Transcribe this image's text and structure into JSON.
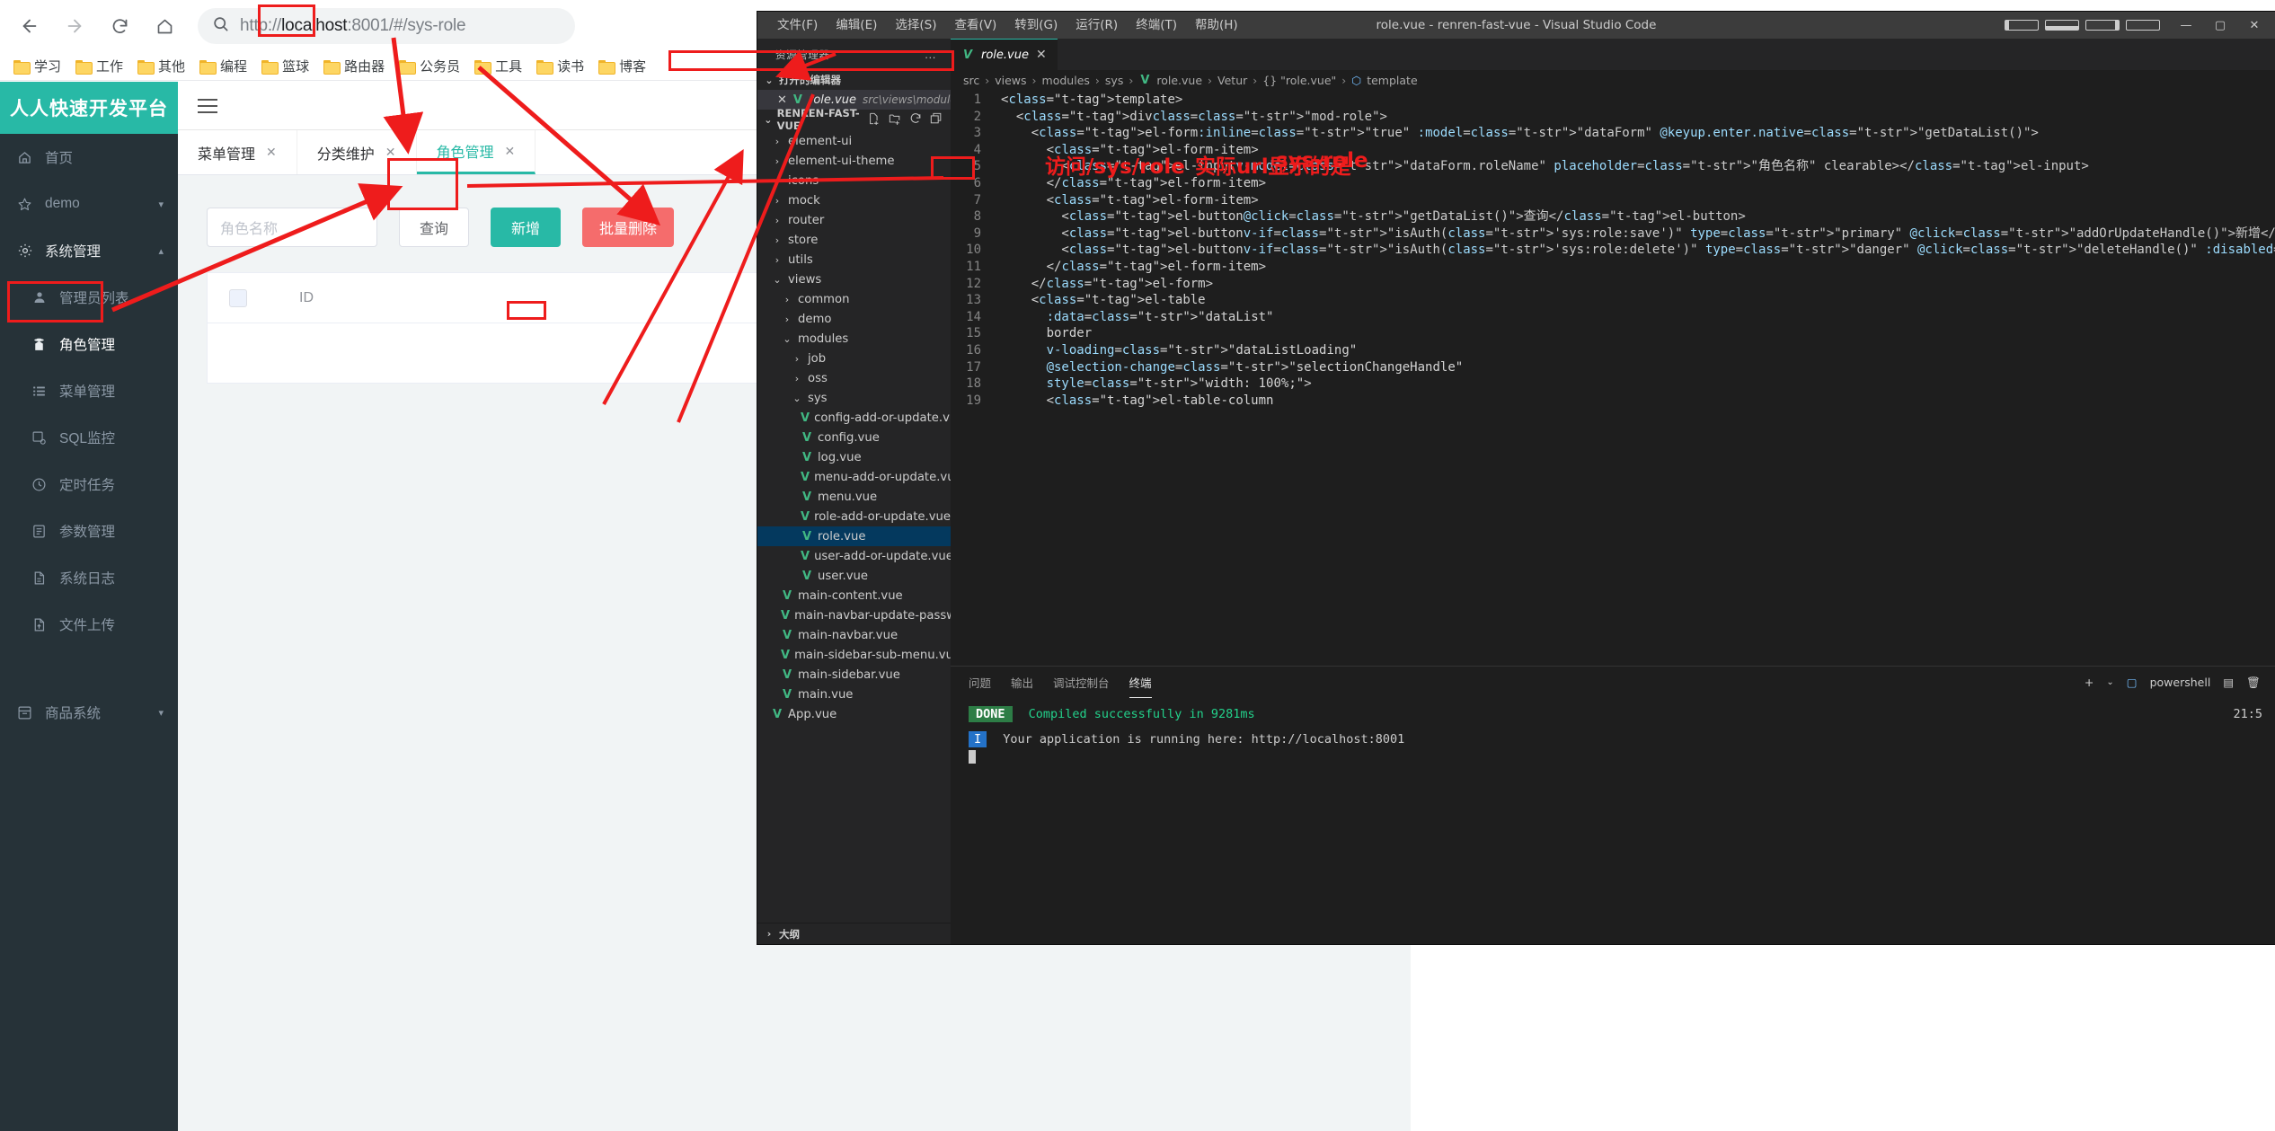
{
  "browser": {
    "nav": {
      "back": "back-arrow",
      "forward": "forward-arrow",
      "reload": "reload",
      "home": "home"
    },
    "omnibox": {
      "search_icon": "search-icon",
      "url_scheme": "http://",
      "url_host": "localhost",
      "url_port": ":8001",
      "url_hash": "/#",
      "url_path": "/sys-role",
      "full_url": "http://localhost:8001/#/sys-role"
    },
    "bookmarks": [
      {
        "label": "学习"
      },
      {
        "label": "工作"
      },
      {
        "label": "其他"
      },
      {
        "label": "编程"
      },
      {
        "label": "篮球"
      },
      {
        "label": "路由器"
      },
      {
        "label": "公务员"
      },
      {
        "label": "工具"
      },
      {
        "label": "读书"
      },
      {
        "label": "博客"
      }
    ]
  },
  "app": {
    "logo": "人人快速开发平台",
    "menu": [
      {
        "label": "首页",
        "icon": "home-icon",
        "level": "top",
        "chevron": ""
      },
      {
        "label": "demo",
        "icon": "star-icon",
        "level": "top",
        "chevron": "▾"
      },
      {
        "label": "系统管理",
        "icon": "gear-icon",
        "level": "top",
        "chevron": "▴",
        "expanded": true
      },
      {
        "label": "管理员列表",
        "icon": "user-icon",
        "level": "sub"
      },
      {
        "label": "角色管理",
        "icon": "role-icon",
        "level": "sub",
        "active": true
      },
      {
        "label": "菜单管理",
        "icon": "list-icon",
        "level": "sub"
      },
      {
        "label": "SQL监控",
        "icon": "sql-icon",
        "level": "sub"
      },
      {
        "label": "定时任务",
        "icon": "clock-icon",
        "level": "sub"
      },
      {
        "label": "参数管理",
        "icon": "params-icon",
        "level": "sub"
      },
      {
        "label": "系统日志",
        "icon": "log-icon",
        "level": "sub"
      },
      {
        "label": "文件上传",
        "icon": "upload-icon",
        "level": "sub"
      },
      {
        "label": "商品系统",
        "icon": "shop-icon",
        "level": "top",
        "chevron": "▾"
      }
    ],
    "navbar": {
      "hamburger": "hamburger-icon"
    },
    "tabs": [
      {
        "label": "菜单管理",
        "closable": true,
        "selected": false
      },
      {
        "label": "分类维护",
        "closable": true,
        "selected": false
      },
      {
        "label": "角色管理",
        "closable": true,
        "selected": true
      }
    ],
    "search": {
      "role_name_placeholder": "角色名称",
      "role_name_value": "",
      "query_button": "查询",
      "add_button": "新增",
      "delete_button": "批量删除"
    },
    "table": {
      "columns": [
        "",
        "ID"
      ],
      "rows": []
    }
  },
  "vscode": {
    "title": "role.vue - renren-fast-vue - Visual Studio Code",
    "menu": [
      "文件(F)",
      "编辑(E)",
      "选择(S)",
      "查看(V)",
      "转到(G)",
      "运行(R)",
      "终端(T)",
      "帮助(H)"
    ],
    "window_controls": {
      "minimize": "—",
      "maximize": "▢",
      "close": "✕"
    },
    "layout_icons": [
      "panel-left-icon",
      "panel-bottom-icon",
      "panel-right-icon",
      "layout-icon"
    ],
    "sidebar": {
      "title": "资源管理器",
      "more": "...",
      "open_editors": {
        "label": "打开的编辑器",
        "chevron": "⌄",
        "items": [
          {
            "close": "✕",
            "icon": "vue-icon",
            "name": "role.vue",
            "path": "src\\views\\modules\\sys"
          }
        ]
      },
      "project": {
        "name": "RENREN-FAST-VUE",
        "chevron": "⌄",
        "actions": [
          "new-file-icon",
          "new-folder-icon",
          "refresh-icon",
          "collapse-icon"
        ]
      },
      "tree": [
        {
          "label": "element-ui",
          "type": "folder",
          "indent": 1,
          "chevron": "›"
        },
        {
          "label": "element-ui-theme",
          "type": "folder",
          "indent": 1,
          "chevron": "›"
        },
        {
          "label": "icons",
          "type": "folder",
          "indent": 1,
          "chevron": "›"
        },
        {
          "label": "mock",
          "type": "folder",
          "indent": 1,
          "chevron": "›"
        },
        {
          "label": "router",
          "type": "folder",
          "indent": 1,
          "chevron": "›"
        },
        {
          "label": "store",
          "type": "folder",
          "indent": 1,
          "chevron": "›"
        },
        {
          "label": "utils",
          "type": "folder",
          "indent": 1,
          "chevron": "›"
        },
        {
          "label": "views",
          "type": "folder",
          "indent": 1,
          "chevron": "⌄",
          "expanded": true
        },
        {
          "label": "common",
          "type": "folder",
          "indent": 2,
          "chevron": "›"
        },
        {
          "label": "demo",
          "type": "folder",
          "indent": 2,
          "chevron": "›"
        },
        {
          "label": "modules",
          "type": "folder",
          "indent": 2,
          "chevron": "⌄",
          "expanded": true
        },
        {
          "label": "job",
          "type": "folder",
          "indent": 3,
          "chevron": "›"
        },
        {
          "label": "oss",
          "type": "folder",
          "indent": 3,
          "chevron": "›"
        },
        {
          "label": "sys",
          "type": "folder",
          "indent": 3,
          "chevron": "⌄",
          "expanded": true,
          "boxed": true
        },
        {
          "label": "config-add-or-update.vue",
          "type": "vue",
          "indent": 4
        },
        {
          "label": "config.vue",
          "type": "vue",
          "indent": 4
        },
        {
          "label": "log.vue",
          "type": "vue",
          "indent": 4
        },
        {
          "label": "menu-add-or-update.vue",
          "type": "vue",
          "indent": 4
        },
        {
          "label": "menu.vue",
          "type": "vue",
          "indent": 4
        },
        {
          "label": "role-add-or-update.vue",
          "type": "vue",
          "indent": 4
        },
        {
          "label": "role.vue",
          "type": "vue",
          "indent": 4,
          "selected": true
        },
        {
          "label": "user-add-or-update.vue",
          "type": "vue",
          "indent": 4
        },
        {
          "label": "user.vue",
          "type": "vue",
          "indent": 4
        },
        {
          "label": "main-content.vue",
          "type": "vue",
          "indent": 2
        },
        {
          "label": "main-navbar-update-password.vue",
          "type": "vue",
          "indent": 2
        },
        {
          "label": "main-navbar.vue",
          "type": "vue",
          "indent": 2
        },
        {
          "label": "main-sidebar-sub-menu.vue",
          "type": "vue",
          "indent": 2
        },
        {
          "label": "main-sidebar.vue",
          "type": "vue",
          "indent": 2
        },
        {
          "label": "main.vue",
          "type": "vue",
          "indent": 2
        },
        {
          "label": "App.vue",
          "type": "vue",
          "indent": 1
        }
      ],
      "outline": {
        "label": "大纲",
        "chevron": "›"
      }
    },
    "editor": {
      "tab": {
        "icon": "vue-icon",
        "name": "role.vue",
        "close": "✕"
      },
      "breadcrumb": [
        "src",
        "views",
        "modules",
        "sys",
        "role.vue",
        "Vetur",
        "{} \"role.vue\"",
        "template"
      ],
      "lines": [
        {
          "n": 1,
          "text": "<template>"
        },
        {
          "n": 2,
          "text": "  <div class=\"mod-role\">"
        },
        {
          "n": 3,
          "text": "    <el-form :inline=\"true\" :model=\"dataForm\" @keyup.enter.native=\"getDataList()\">"
        },
        {
          "n": 4,
          "text": "      <el-form-item>"
        },
        {
          "n": 5,
          "text": "        <el-input v-model=\"dataForm.roleName\" placeholder=\"角色名称\" clearable></el-input>"
        },
        {
          "n": 6,
          "text": "      </el-form-item>"
        },
        {
          "n": 7,
          "text": "      <el-form-item>"
        },
        {
          "n": 8,
          "text": "        <el-button @click=\"getDataList()\">查询</el-button>"
        },
        {
          "n": 9,
          "text": "        <el-button v-if=\"isAuth('sys:role:save')\" type=\"primary\" @click=\"addOrUpdateHandle()\">新增</el-button>"
        },
        {
          "n": 10,
          "text": "        <el-button v-if=\"isAuth('sys:role:delete')\" type=\"danger\" @click=\"deleteHandle()\" :disabled=\"dataListSelections.length"
        },
        {
          "n": 11,
          "text": "      </el-form-item>"
        },
        {
          "n": 12,
          "text": "    </el-form>"
        },
        {
          "n": 13,
          "text": "    <el-table"
        },
        {
          "n": 14,
          "text": "      :data=\"dataList\""
        },
        {
          "n": 15,
          "text": "      border"
        },
        {
          "n": 16,
          "text": "      v-loading=\"dataListLoading\""
        },
        {
          "n": 17,
          "text": "      @selection-change=\"selectionChangeHandle\""
        },
        {
          "n": 18,
          "text": "      style=\"width: 100%;\">"
        },
        {
          "n": 19,
          "text": "      <el-table-column"
        }
      ]
    },
    "panel": {
      "tabs": [
        "问题",
        "输出",
        "调试控制台",
        "终端"
      ],
      "active_tab": "终端",
      "add_icon": "+",
      "shell_icon": "terminal-icon",
      "shell_name": "powershell",
      "split_icon": "split-icon",
      "trash_icon": "trash-icon",
      "terminal": {
        "status_badge": "DONE",
        "status_text": "Compiled successfully in 9281ms",
        "info_badge": "I",
        "info_text": "Your application is running here: http://localhost:8001",
        "time": "21:5"
      }
    }
  },
  "annotations": {
    "note_visit": "访问/sys/role",
    "note_actual": "实际url显示的是",
    "note_actual2": "sys-role",
    "boxes": [
      "url-sys-role",
      "sidebar-role-management",
      "query-button",
      "code-query-button",
      "breadcrumb-path",
      "tree-sys-folder"
    ]
  }
}
